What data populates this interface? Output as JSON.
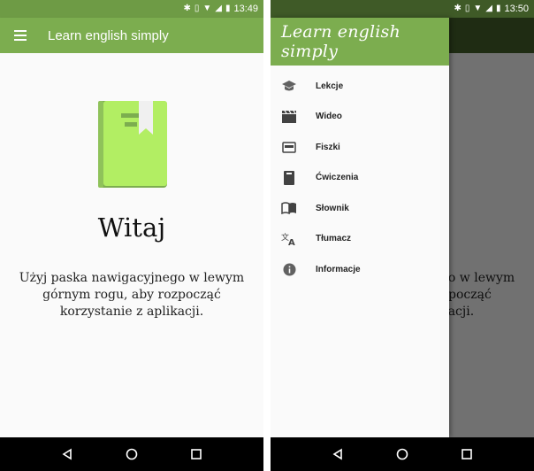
{
  "status_left": {
    "time": "13:49"
  },
  "status_right": {
    "time": "13:50"
  },
  "app": {
    "title": "Learn english simply"
  },
  "main": {
    "heading": "Witaj",
    "message": "Użyj paska nawigacyjnego w lewym górnym rogu, aby rozpocząć korzystanie z aplikacji."
  },
  "drawer": {
    "title": "Learn english simply",
    "items": [
      {
        "label": "Lekcje",
        "icon": "graduation-cap-icon"
      },
      {
        "label": "Wideo",
        "icon": "video-clapper-icon"
      },
      {
        "label": "Fiszki",
        "icon": "flashcards-icon"
      },
      {
        "label": "Ćwiczenia",
        "icon": "exercise-book-icon"
      },
      {
        "label": "Słownik",
        "icon": "open-book-icon"
      },
      {
        "label": "Tłumacz",
        "icon": "translate-icon"
      },
      {
        "label": "Informacje",
        "icon": "info-icon"
      }
    ]
  },
  "colors": {
    "primary": "#7cad4f",
    "status_bar": "#6e9b45",
    "book_green": "#b2ee63"
  }
}
